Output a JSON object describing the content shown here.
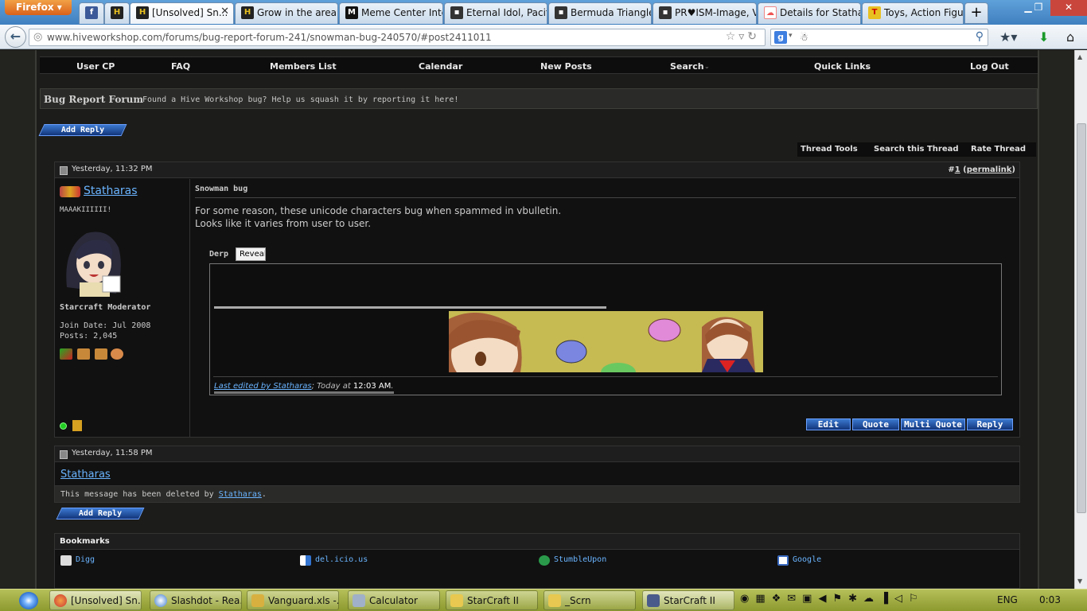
{
  "browser": {
    "app_name": "Firefox",
    "tabs": [
      {
        "label": "",
        "icon": "facebook-icon",
        "color": "#3b5998"
      },
      {
        "label": "",
        "icon": "hive-icon",
        "color": "#222"
      },
      {
        "label": "[Unsolved] Sn...",
        "icon": "hive-icon",
        "color": "#222",
        "selected": true
      },
      {
        "label": "Grow in the area ...",
        "icon": "hive-icon",
        "color": "#222"
      },
      {
        "label": "Meme Center Inte...",
        "icon": "mc-icon",
        "color": "#111"
      },
      {
        "label": "Eternal Idol, Pacifi...",
        "icon": "site-icon",
        "color": "#222"
      },
      {
        "label": "Bermuda Triangle...",
        "icon": "site-icon",
        "color": "#222"
      },
      {
        "label": "PR♥ISM-Image, V...",
        "icon": "site-icon",
        "color": "#222"
      },
      {
        "label": "Details for Stathar...",
        "icon": "cloud-icon",
        "color": "#e88"
      },
      {
        "label": "Toys, Action Figu...",
        "icon": "tru-icon",
        "color": "#e8c020"
      }
    ],
    "url": "www.hiveworkshop.com/forums/bug-report-forum-241/snowman-bug-240570/#post2411011",
    "search_engine": "Google",
    "search_value": "☃"
  },
  "forum": {
    "nav": [
      "User CP",
      "FAQ",
      "Members List",
      "Calendar",
      "New Posts",
      "Search",
      "Quick Links",
      "Log Out"
    ],
    "forum_title": "Bug Report Forum",
    "forum_desc": "Found a Hive Workshop bug? Help us squash it by reporting it here!",
    "add_reply": "Add Reply",
    "thread_tools": [
      "Thread Tools",
      "Search this Thread",
      "Rate Thread"
    ]
  },
  "post1": {
    "date": "Yesterday, 11:32 PM",
    "number_prefix": "#",
    "number": "1",
    "permalink": "permalink",
    "username": "Statharas",
    "user_title": "MAAAKIIIIII!",
    "user_rank": "Starcraft Moderator",
    "join_date": "Join Date: Jul 2008",
    "posts": "Posts: 2,045",
    "title": "Snowman bug",
    "message_line1": "For some reason, these unicode characters bug when spammed in vbulletin.",
    "message_line2": "Looks like it varies from user to user.",
    "spoiler_label": "Derp",
    "reveal_button": "Reveal",
    "edit_link": "Last edited by Statharas",
    "edit_time_prefix": "; Today at ",
    "edit_time": "12:03 AM",
    "buttons": [
      "Edit",
      "Quote",
      "Multi Quote",
      "Reply"
    ]
  },
  "post2": {
    "date": "Yesterday, 11:58 PM",
    "username": "Statharas",
    "deleted_text": "This message has been deleted by ",
    "deleted_by": "Statharas"
  },
  "bookmarks": {
    "title": "Bookmarks",
    "items": [
      "Digg",
      "del.icio.us",
      "StumbleUpon",
      "Google"
    ]
  },
  "taskbar": {
    "buttons": [
      "[Unsolved] Sn...",
      "Slashdot - Rea...",
      "Vanguard.xls -...",
      "Calculator",
      "StarCraft II",
      "_Scrn",
      "StarCraft II"
    ],
    "language": "ENG",
    "clock": "0:03"
  }
}
